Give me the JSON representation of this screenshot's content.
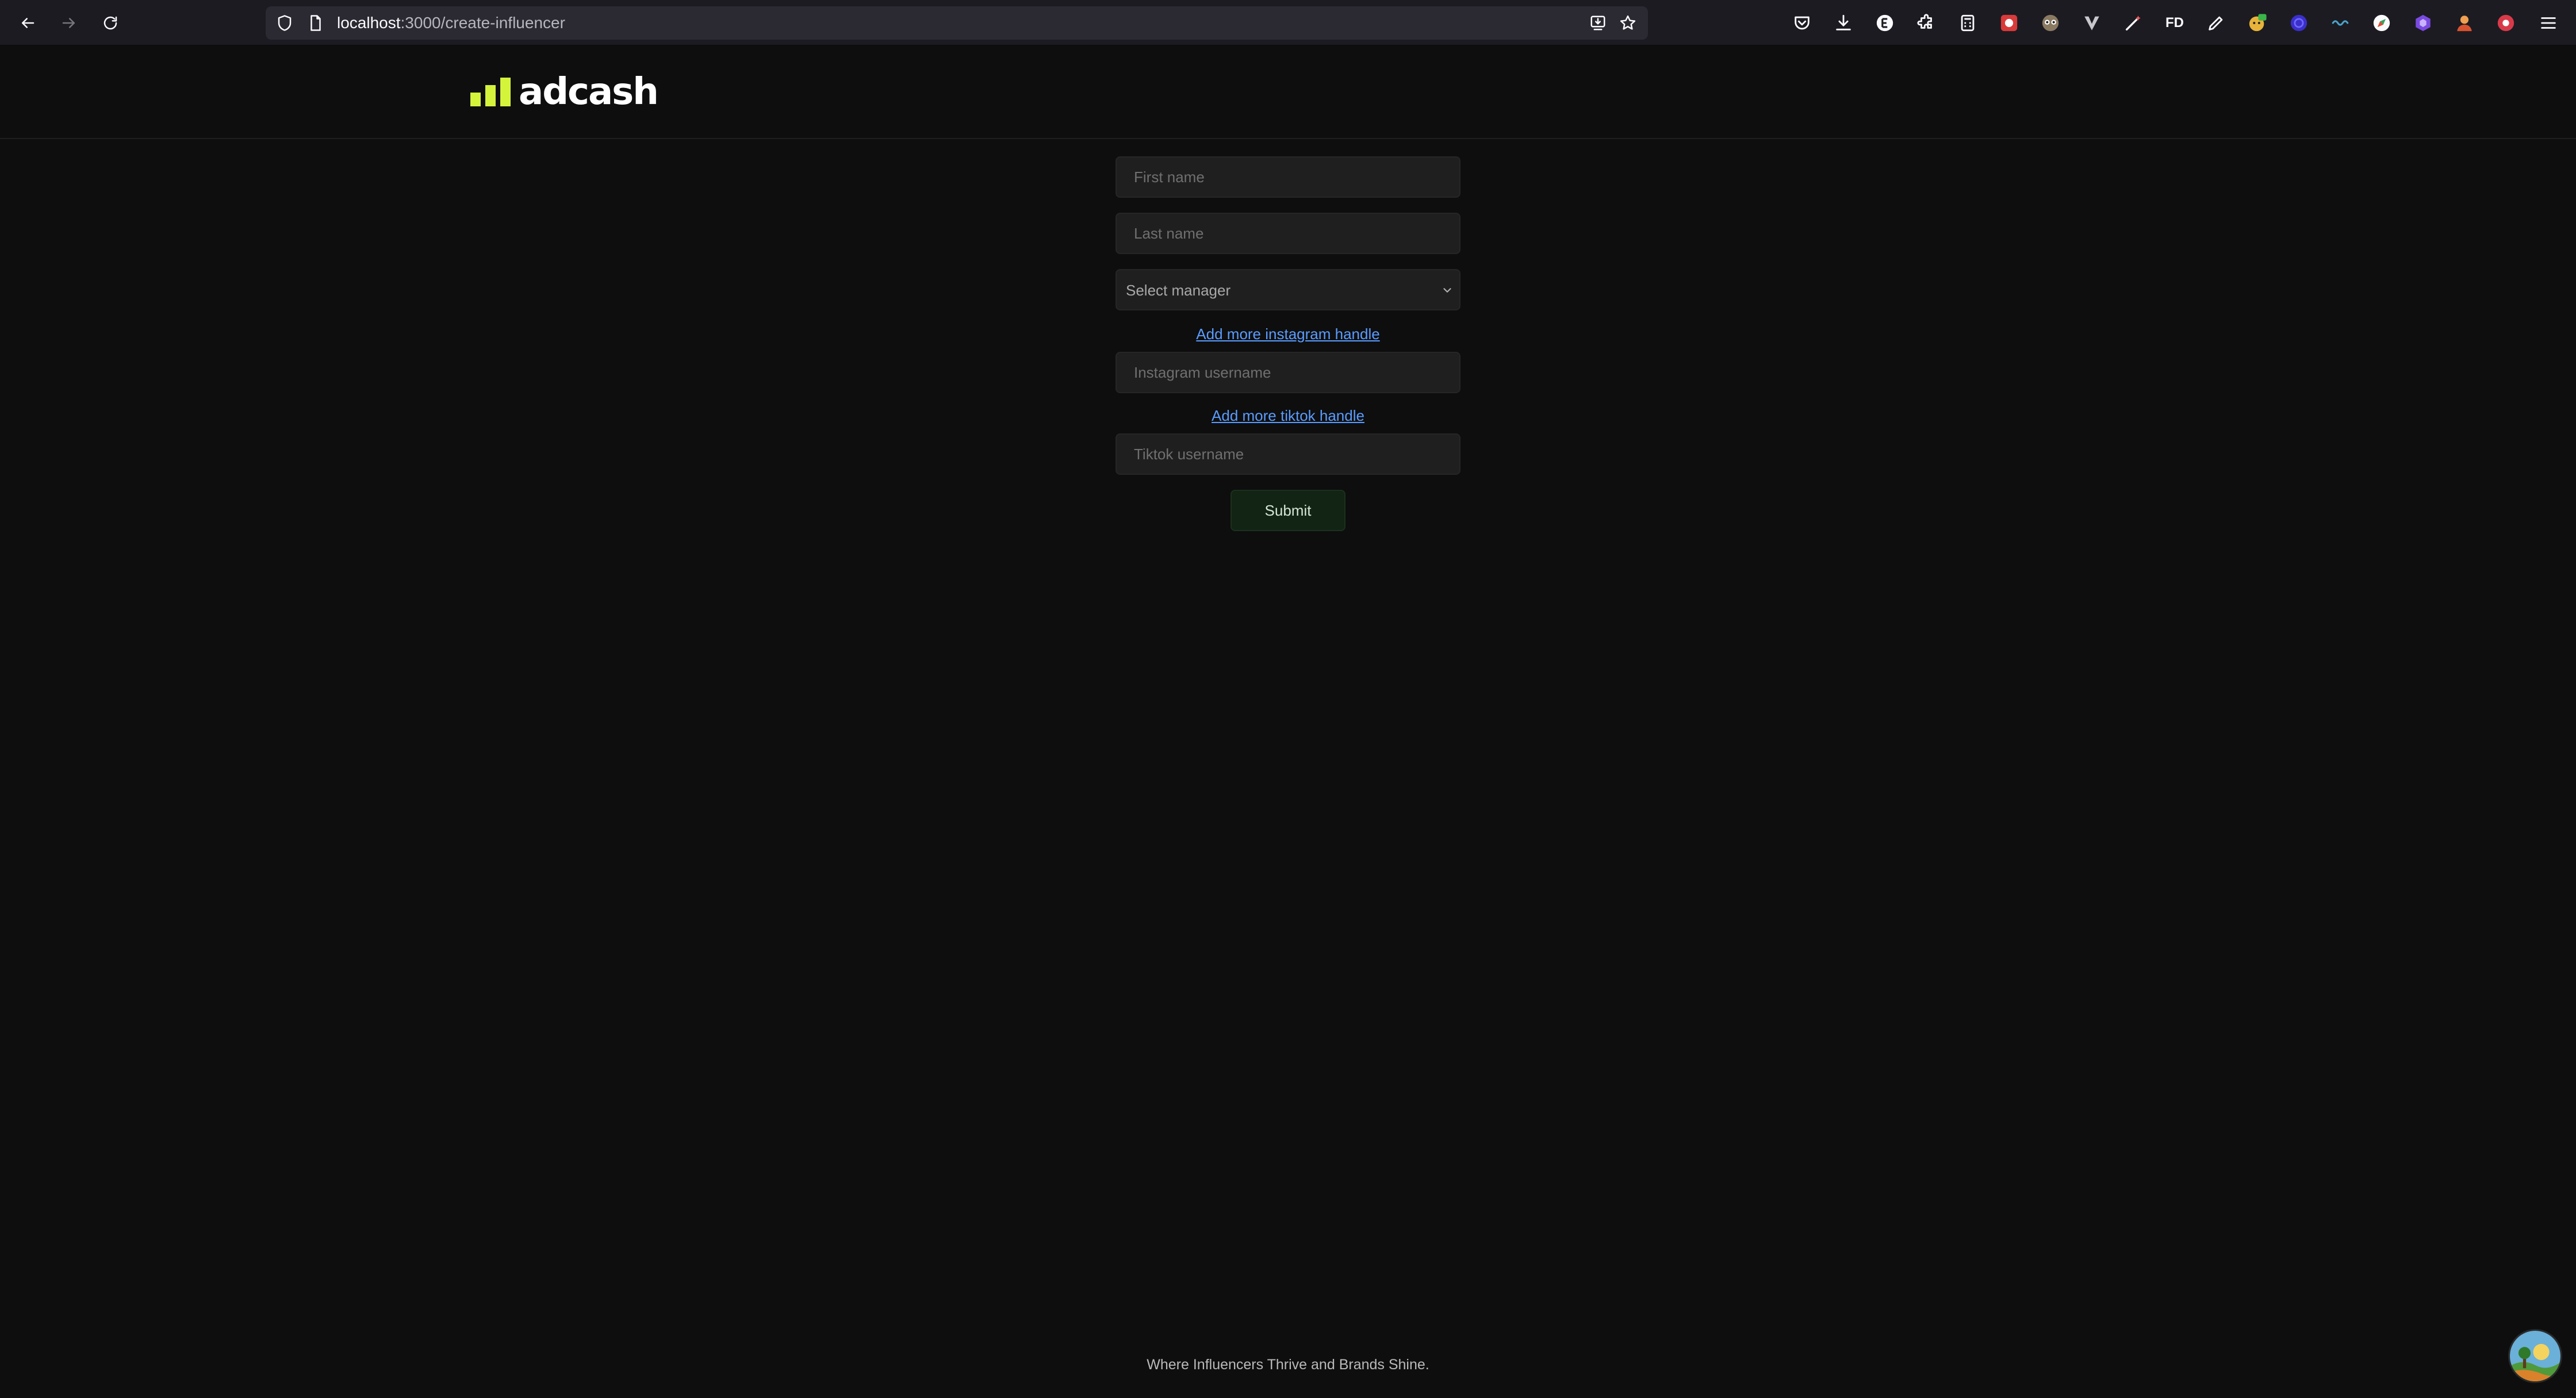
{
  "browser": {
    "url_host": "localhost",
    "url_path": ":3000/create-influencer",
    "extension_labels": {
      "fd": "FD"
    }
  },
  "header": {
    "logo_text": "adcash",
    "brand_color": "#d4f33b"
  },
  "form": {
    "first_name_placeholder": "First name",
    "last_name_placeholder": "Last name",
    "manager_select_value": "Select manager",
    "add_instagram_link": "Add more instagram handle",
    "instagram_placeholder": "Instagram username",
    "add_tiktok_link": "Add more tiktok handle",
    "tiktok_placeholder": "Tiktok username",
    "submit_label": "Submit"
  },
  "footer": {
    "tagline": "Where Influencers Thrive and Brands Shine."
  },
  "colors": {
    "background": "#0e0e0e",
    "field_background": "#1f1f1f",
    "link": "#5a9cff",
    "submit_background": "#122414"
  }
}
